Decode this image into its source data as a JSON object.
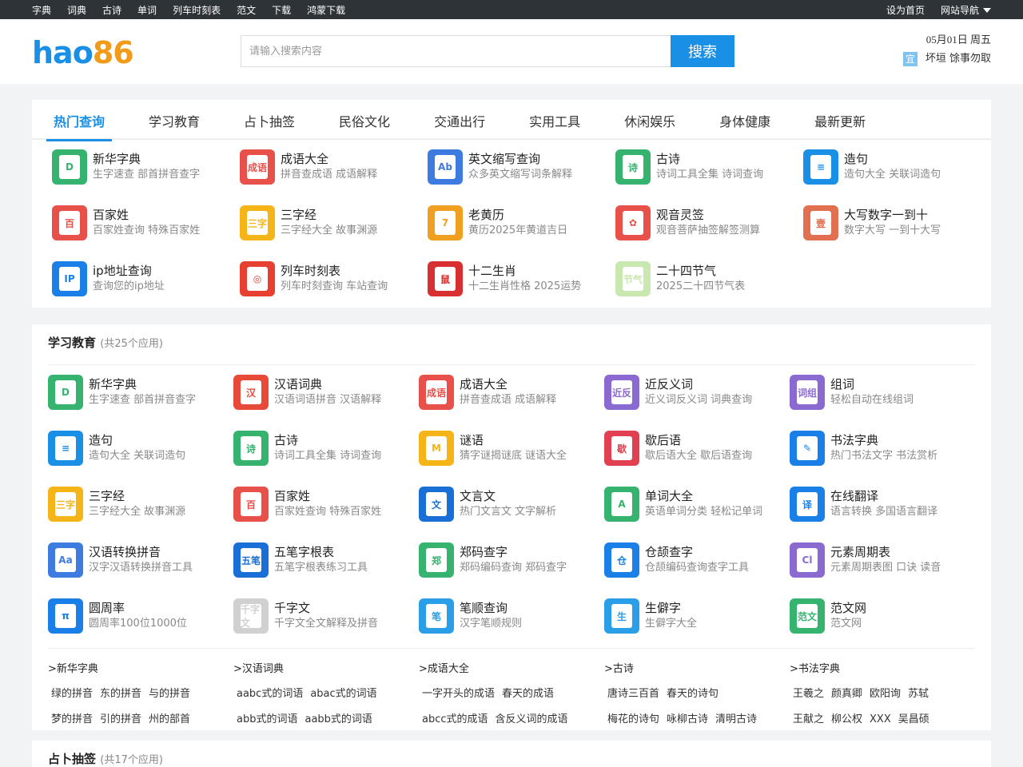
{
  "topbar": {
    "nav": [
      "字典",
      "词典",
      "古诗",
      "单词",
      "列车时刻表",
      "范文",
      "下载",
      "鸿蒙下载"
    ],
    "home": "设为首页",
    "sitenav": "网站导航"
  },
  "header": {
    "logo_a": "hao",
    "logo_b": "86",
    "search_placeholder": "请输入搜索内容",
    "search_button": "搜索",
    "date": "05月01日 周五",
    "yi_tag": "宜",
    "yi_text": "坏垣 馀事勿取"
  },
  "tabs": [
    "热门查询",
    "学习教育",
    "占卜抽签",
    "民俗文化",
    "交通出行",
    "实用工具",
    "休闲娱乐",
    "身体健康",
    "最新更新"
  ],
  "hot": [
    {
      "t": "新华字典",
      "d": "生字速查 部首拼音查字",
      "c": "#35b36f",
      "g": "D"
    },
    {
      "t": "成语大全",
      "d": "拼音查成语 成语解释",
      "c": "#e8504a",
      "g": "成语"
    },
    {
      "t": "英文缩写查询",
      "d": "众多英文缩写词条解释",
      "c": "#3d7be0",
      "g": "Ab"
    },
    {
      "t": "古诗",
      "d": "诗词工具全集 诗词查询",
      "c": "#35b36f",
      "g": "诗"
    },
    {
      "t": "造句",
      "d": "造句大全 关联词造句",
      "c": "#1a8fe6",
      "g": "≡"
    },
    {
      "t": "百家姓",
      "d": "百家姓查询 特殊百家姓",
      "c": "#e8504a",
      "g": "百"
    },
    {
      "t": "三字经",
      "d": "三字经大全 故事渊源",
      "c": "#f5b417",
      "g": "三字"
    },
    {
      "t": "老黄历",
      "d": "黄历2025年黄道吉日",
      "c": "#f0a020",
      "g": "7"
    },
    {
      "t": "观音灵签",
      "d": "观音菩萨抽签解签测算",
      "c": "#e8504a",
      "g": "✿"
    },
    {
      "t": "大写数字一到十",
      "d": "数字大写 一到十大写",
      "c": "#e07050",
      "g": "壹"
    },
    {
      "t": "ip地址查询",
      "d": "查询您的ip地址",
      "c": "#1a7fe6",
      "g": "IP"
    },
    {
      "t": "列车时刻表",
      "d": "列车时刻查询 车站查询",
      "c": "#e84030",
      "g": "◎"
    },
    {
      "t": "十二生肖",
      "d": "十二生肖性格 2025运势",
      "c": "#d83030",
      "g": "鼠"
    },
    {
      "t": "二十四节气",
      "d": "2025二十四节气表",
      "c": "#c8e8b0",
      "g": "节气"
    }
  ],
  "edu": {
    "title": "学习教育",
    "count": "(共25个应用)",
    "apps": [
      {
        "t": "新华字典",
        "d": "生字速查 部首拼音查字",
        "c": "#35b36f",
        "g": "D"
      },
      {
        "t": "汉语词典",
        "d": "汉语词语拼音 汉语解释",
        "c": "#e84a3a",
        "g": "汉"
      },
      {
        "t": "成语大全",
        "d": "拼音查成语 成语解释",
        "c": "#e8504a",
        "g": "成语"
      },
      {
        "t": "近反义词",
        "d": "近义词反义词 词典查询",
        "c": "#8a6ad0",
        "g": "近反"
      },
      {
        "t": "组词",
        "d": "轻松自动在线组词",
        "c": "#8a6ad0",
        "g": "词组"
      },
      {
        "t": "造句",
        "d": "造句大全 关联词造句",
        "c": "#1a8fe6",
        "g": "≡"
      },
      {
        "t": "古诗",
        "d": "诗词工具全集 诗词查询",
        "c": "#35b36f",
        "g": "诗"
      },
      {
        "t": "谜语",
        "d": "猜字谜揭谜底 谜语大全",
        "c": "#f5b417",
        "g": "M"
      },
      {
        "t": "歇后语",
        "d": "歇后语大全 歇后语查询",
        "c": "#e04050",
        "g": "歇"
      },
      {
        "t": "书法字典",
        "d": "热门书法文字 书法赏析",
        "c": "#1a7fe6",
        "g": "✎"
      },
      {
        "t": "三字经",
        "d": "三字经大全 故事渊源",
        "c": "#f5b417",
        "g": "三字"
      },
      {
        "t": "百家姓",
        "d": "百家姓查询 特殊百家姓",
        "c": "#e8504a",
        "g": "百"
      },
      {
        "t": "文言文",
        "d": "热门文言文 文字解析",
        "c": "#1a6fd6",
        "g": "文"
      },
      {
        "t": "单词大全",
        "d": "英语单词分类 轻松记单词",
        "c": "#35b36f",
        "g": "A"
      },
      {
        "t": "在线翻译",
        "d": "语言转换 多国语言翻译",
        "c": "#1a7fe6",
        "g": "译"
      },
      {
        "t": "汉语转换拼音",
        "d": "汉字汉语转换拼音工具",
        "c": "#3d7be0",
        "g": "Aa"
      },
      {
        "t": "五笔字根表",
        "d": "五笔字根表练习工具",
        "c": "#1a6fd6",
        "g": "五笔"
      },
      {
        "t": "郑码查字",
        "d": "郑码编码查询 郑码查字",
        "c": "#35b36f",
        "g": "郑"
      },
      {
        "t": "仓颉查字",
        "d": "仓颉编码查询查字工具",
        "c": "#1a7fe6",
        "g": "仓"
      },
      {
        "t": "元素周期表",
        "d": "元素周期表图 口诀 读音",
        "c": "#8a6ad0",
        "g": "Cl"
      },
      {
        "t": "圆周率",
        "d": "圆周率100位1000位",
        "c": "#1a7fe6",
        "g": "π"
      },
      {
        "t": "千字文",
        "d": "千字文全文解释及拼音",
        "c": "#d0d0d0",
        "g": "千字文"
      },
      {
        "t": "笔顺查询",
        "d": "汉字笔顺规则",
        "c": "#2a9ee6",
        "g": "笔"
      },
      {
        "t": "生僻字",
        "d": "生僻字大全",
        "c": "#2a9ee6",
        "g": "生"
      },
      {
        "t": "范文网",
        "d": "范文网",
        "c": "#35b36f",
        "g": "范文"
      }
    ],
    "links": [
      {
        "h": ">新华字典",
        "r1": [
          "绿的拼音",
          "东的拼音",
          "与的拼音"
        ],
        "r2": [
          "梦的拼音",
          "引的拼音",
          "州的部首"
        ]
      },
      {
        "h": ">汉语词典",
        "r1": [
          "aabc式的词语",
          "abac式的词语"
        ],
        "r2": [
          "abb式的词语",
          "aabb式的词语"
        ]
      },
      {
        "h": ">成语大全",
        "r1": [
          "一字开头的成语",
          "春天的成语"
        ],
        "r2": [
          "abcc式的成语",
          "含反义词的成语"
        ]
      },
      {
        "h": ">古诗",
        "r1": [
          "唐诗三百首",
          "春天的诗句"
        ],
        "r2": [
          "梅花的诗句",
          "咏柳古诗",
          "清明古诗"
        ]
      },
      {
        "h": ">书法字典",
        "r1": [
          "王羲之",
          "颜真卿",
          "欧阳询",
          "苏轼"
        ],
        "r2": [
          "王献之",
          "柳公权",
          "XXX",
          "吴昌硕"
        ]
      }
    ]
  },
  "zhanbu": {
    "title": "占卜抽签",
    "count": "(共17个应用)"
  }
}
